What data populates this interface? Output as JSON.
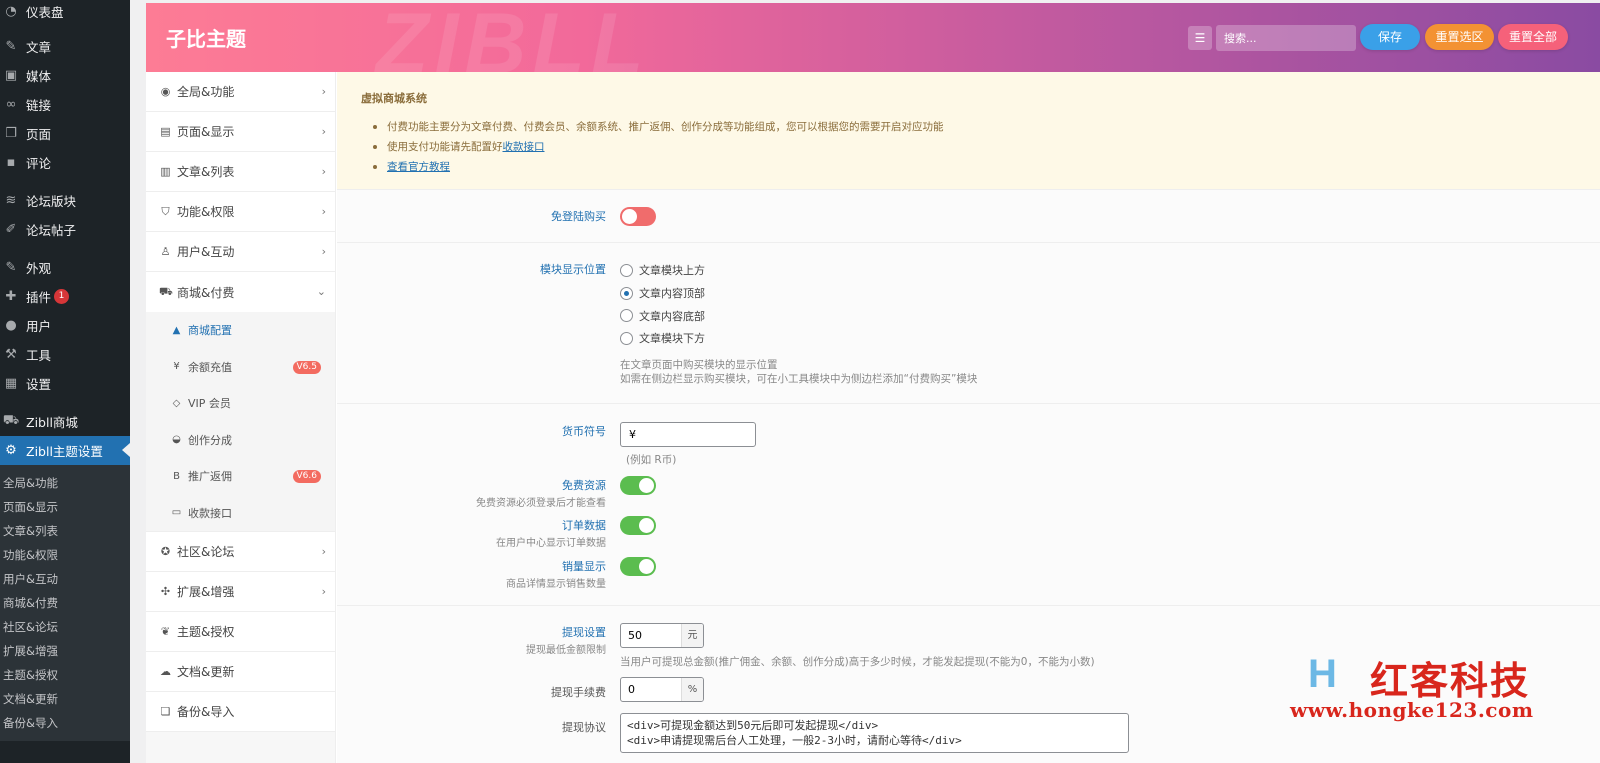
{
  "wp_sidebar": {
    "items": [
      {
        "label": "仪表盘",
        "icon": "dashboard-icon"
      },
      {
        "label": "文章",
        "icon": "pin-icon"
      },
      {
        "label": "媒体",
        "icon": "media-icon"
      },
      {
        "label": "链接",
        "icon": "link-icon"
      },
      {
        "label": "页面",
        "icon": "page-icon"
      },
      {
        "label": "评论",
        "icon": "comment-icon"
      },
      {
        "label": "论坛版块",
        "icon": "forum-icon"
      },
      {
        "label": "论坛帖子",
        "icon": "post-icon"
      },
      {
        "label": "外观",
        "icon": "brush-icon"
      },
      {
        "label": "插件",
        "icon": "plugin-icon",
        "badge": "1"
      },
      {
        "label": "用户",
        "icon": "user-icon"
      },
      {
        "label": "工具",
        "icon": "wrench-icon"
      },
      {
        "label": "设置",
        "icon": "settings-icon"
      },
      {
        "label": "Zibll商城",
        "icon": "cart-icon"
      },
      {
        "label": "Zibll主题设置",
        "icon": "gear-icon"
      }
    ],
    "submenu": [
      "全局&功能",
      "页面&显示",
      "文章&列表",
      "功能&权限",
      "用户&互动",
      "商城&付费",
      "社区&论坛",
      "扩展&增强",
      "主题&授权",
      "文档&更新",
      "备份&导入"
    ]
  },
  "header": {
    "title": "子比主题",
    "bg_text": "ZIBLL",
    "search_placeholder": "搜索...",
    "save_label": "保存",
    "reset_section_label": "重置选区",
    "reset_all_label": "重置全部",
    "colors": {
      "save": "#3aa0e8",
      "reset_section": "#f39233",
      "reset_all": "#f5617a"
    }
  },
  "nav": {
    "items_top": [
      {
        "label": "全局&功能",
        "icon": "globe-icon"
      },
      {
        "label": "页面&显示",
        "icon": "calendar-icon"
      },
      {
        "label": "文章&列表",
        "icon": "map-icon"
      },
      {
        "label": "功能&权限",
        "icon": "shield-icon"
      },
      {
        "label": "用户&互动",
        "icon": "user-icon"
      },
      {
        "label": "商城&付费",
        "icon": "cart-icon"
      }
    ],
    "sub_items": [
      {
        "label": "商城配置",
        "icon": "bag-icon"
      },
      {
        "label": "余额充值",
        "icon": "yen-icon",
        "badge": "V6.5"
      },
      {
        "label": "VIP 会员",
        "icon": "diamond-icon"
      },
      {
        "label": "创作分成",
        "icon": "inbox-icon"
      },
      {
        "label": "推广返佣",
        "icon": "bitcoin-icon",
        "badge": "V6.6"
      },
      {
        "label": "收款接口",
        "icon": "card-icon"
      }
    ],
    "items_bottom": [
      {
        "label": "社区&论坛",
        "icon": "compass-icon"
      },
      {
        "label": "扩展&增强",
        "icon": "puzzle-icon"
      },
      {
        "label": "主题&授权",
        "icon": "sprout-icon"
      },
      {
        "label": "文档&更新",
        "icon": "cloud-icon"
      },
      {
        "label": "备份&导入",
        "icon": "copy-icon"
      }
    ]
  },
  "notice": {
    "title": "虚拟商城系统",
    "line1": "付费功能主要分为文章付费、付费会员、余额系统、推广返佣、创作分成等功能组成，您可以根据您的需要开启对应功能",
    "line2_prefix": "使用支付功能请先配置好",
    "line2_link": "收款接口",
    "line3_link": "查看官方教程"
  },
  "fields": {
    "free_login_buy": {
      "label": "免登陆购买",
      "on": false
    },
    "module_position": {
      "label": "模块显示位置",
      "options": [
        "文章模块上方",
        "文章内容顶部",
        "文章内容底部",
        "文章模块下方"
      ],
      "selected": "文章内容顶部",
      "help1": "在文章页面中购买模块的显示位置",
      "help2": "如需在侧边栏显示购买模块，可在小工具模块中为侧边栏添加“付费购买”模块"
    },
    "currency": {
      "label": "货币符号",
      "value": "¥",
      "help": "(例如 R币)"
    },
    "free_resource": {
      "label": "免费资源",
      "sub": "免费资源必须登录后才能查看",
      "on": true
    },
    "order_data": {
      "label": "订单数据",
      "sub": "在用户中心显示订单数据",
      "on": true
    },
    "sales_display": {
      "label": "销量显示",
      "sub": "商品详情显示销售数量",
      "on": true
    },
    "withdraw": {
      "label": "提现设置",
      "sub": "提现最低金额限制",
      "value": "50",
      "unit": "元",
      "help": "当用户可提现总金额(推广佣金、余额、创作分成)高于多少时候，才能发起提现(不能为0，不能为小数)"
    },
    "fee": {
      "label": "提现手续费",
      "value": "0",
      "unit": "%"
    },
    "agreement": {
      "label": "提现协议",
      "value": "<div>可提现金额达到50元后即可发起提现</div>\n<div>申请提现需后台人工处理，一般2-3小时，请耐心等待</div>"
    }
  },
  "watermark": {
    "brand": "红客科技",
    "url": "www.hongke123.com",
    "logo": "H"
  }
}
